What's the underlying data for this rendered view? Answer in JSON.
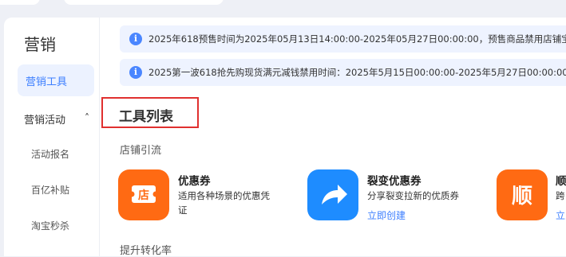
{
  "sidebar": {
    "title": "营销",
    "active_item": "营销工具",
    "section": "营销活动",
    "section_chevron": "˄",
    "sub_items": [
      "活动报名",
      "百亿补贴",
      "淘宝秒杀"
    ]
  },
  "notices": [
    {
      "icon": "info-icon",
      "text": "2025年618预售时间为2025年05月13日14:00:00-2025年05月27日00:00:00，预售商品禁用店铺宝时间"
    },
    {
      "icon": "info-icon",
      "text": "2025第一波618抢先购现货满元减钱禁用时间：2025年5月15日00:00:00-2025年5月27日00:00:00。2"
    }
  ],
  "tool_list": {
    "title": "工具列表",
    "groups": [
      {
        "name": "店铺引流",
        "tools": [
          {
            "icon": "coupon-shop-icon",
            "icon_text": "店",
            "color": "#ff6a13",
            "name": "优惠券",
            "desc_line1": "适用各种场景的优惠凭",
            "desc_line2": "证",
            "link": ""
          },
          {
            "icon": "share-arrow-icon",
            "icon_text": "",
            "color": "#1e8cff",
            "name": "裂变优惠券",
            "desc_line1": "分享裂变拉新的优质券",
            "desc_line2": "",
            "link": "立即创建"
          },
          {
            "icon": "shun-icon",
            "icon_text": "顺",
            "color": "#ff6a13",
            "name": "顺",
            "desc_line1": "跨",
            "desc_line2": "",
            "link": "立即"
          }
        ]
      },
      {
        "name": "提升转化率",
        "tools": []
      }
    ]
  }
}
